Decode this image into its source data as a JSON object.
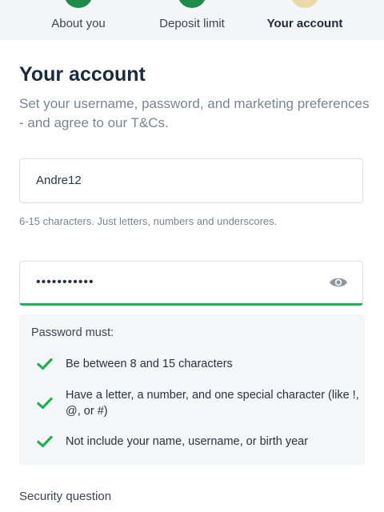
{
  "stepper": {
    "steps": [
      {
        "label": "About you",
        "state": "completed"
      },
      {
        "label": "Deposit limit",
        "state": "completed"
      },
      {
        "label": "Your account",
        "state": "current"
      }
    ]
  },
  "page": {
    "title": "Your account",
    "subtitle": "Set your username, password, and marketing preferences - and agree to our T&Cs."
  },
  "username": {
    "value": "Andre12",
    "hint": "6-15 characters. Just letters, numbers and underscores."
  },
  "password": {
    "masked_value": "•••••••••••",
    "valid": true,
    "toggle_icon": "eye-icon"
  },
  "password_rules": {
    "title": "Password must:",
    "items": [
      {
        "text": "Be between 8 and 15 characters",
        "met": true
      },
      {
        "text": "Have a letter, a number, and one special character (like !, @, or #)",
        "met": true
      },
      {
        "text": "Not include your name, username, or birth year",
        "met": true
      }
    ]
  },
  "security_question": {
    "label": "Security question"
  },
  "colors": {
    "success": "#1fb04f",
    "step_done": "#1f8b4c",
    "step_current": "#e9d9a8",
    "title": "#1c2a3d"
  }
}
